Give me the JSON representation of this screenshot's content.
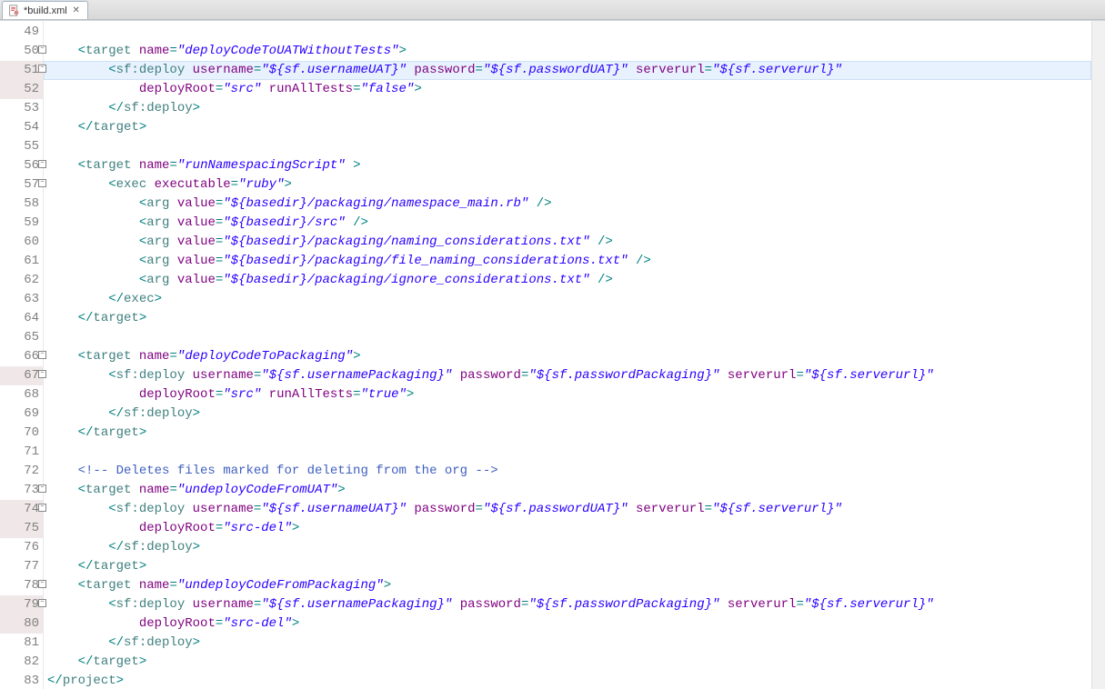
{
  "tab": {
    "filename": "*build.xml"
  },
  "lines": [
    {
      "n": 49,
      "fold": false,
      "mod": false,
      "hl": false,
      "html": ""
    },
    {
      "n": 50,
      "fold": true,
      "mod": false,
      "hl": false,
      "html": "    <span class='punct'>&lt;</span><span class='tag'>target</span> <span class='attr'>name</span><span class='punct'>=</span><span class='val'>\"deployCodeToUATWithoutTests\"</span><span class='punct'>&gt;</span>"
    },
    {
      "n": 51,
      "fold": true,
      "mod": true,
      "hl": true,
      "html": "        <span class='punct'>&lt;</span><span class='tag'>sf:deploy</span> <span class='attr'>username</span><span class='punct'>=</span><span class='val'>\"${sf.usernameUAT}\"</span> <span class='attr'>password</span><span class='punct'>=</span><span class='val'>\"${sf.passwordUAT}\"</span> <span class='attr'>serverurl</span><span class='punct'>=</span><span class='val'>\"${sf.serverurl}\"</span>"
    },
    {
      "n": 52,
      "fold": false,
      "mod": true,
      "hl": false,
      "html": "            <span class='attr'>deployRoot</span><span class='punct'>=</span><span class='val'>\"src\"</span> <span class='attr'>runAllTests</span><span class='punct'>=</span><span class='val'>\"false\"</span><span class='punct'>&gt;</span>"
    },
    {
      "n": 53,
      "fold": false,
      "mod": false,
      "hl": false,
      "html": "        <span class='punct'>&lt;/</span><span class='tag'>sf:deploy</span><span class='punct'>&gt;</span>"
    },
    {
      "n": 54,
      "fold": false,
      "mod": false,
      "hl": false,
      "html": "    <span class='punct'>&lt;/</span><span class='tag'>target</span><span class='punct'>&gt;</span>"
    },
    {
      "n": 55,
      "fold": false,
      "mod": false,
      "hl": false,
      "html": ""
    },
    {
      "n": 56,
      "fold": true,
      "mod": false,
      "hl": false,
      "html": "    <span class='punct'>&lt;</span><span class='tag'>target</span> <span class='attr'>name</span><span class='punct'>=</span><span class='val'>\"runNamespacingScript\"</span> <span class='punct'>&gt;</span>"
    },
    {
      "n": 57,
      "fold": true,
      "mod": false,
      "hl": false,
      "html": "        <span class='punct'>&lt;</span><span class='tag'>exec</span> <span class='attr'>executable</span><span class='punct'>=</span><span class='val'>\"ruby\"</span><span class='punct'>&gt;</span>"
    },
    {
      "n": 58,
      "fold": false,
      "mod": false,
      "hl": false,
      "html": "            <span class='punct'>&lt;</span><span class='tag'>arg</span> <span class='attr'>value</span><span class='punct'>=</span><span class='val'>\"${basedir}/packaging/namespace_main.rb\"</span> <span class='punct'>/&gt;</span>"
    },
    {
      "n": 59,
      "fold": false,
      "mod": false,
      "hl": false,
      "html": "            <span class='punct'>&lt;</span><span class='tag'>arg</span> <span class='attr'>value</span><span class='punct'>=</span><span class='val'>\"${basedir}/src\"</span> <span class='punct'>/&gt;</span>"
    },
    {
      "n": 60,
      "fold": false,
      "mod": false,
      "hl": false,
      "html": "            <span class='punct'>&lt;</span><span class='tag'>arg</span> <span class='attr'>value</span><span class='punct'>=</span><span class='val'>\"${basedir}/packaging/naming_considerations.txt\"</span> <span class='punct'>/&gt;</span>"
    },
    {
      "n": 61,
      "fold": false,
      "mod": false,
      "hl": false,
      "html": "            <span class='punct'>&lt;</span><span class='tag'>arg</span> <span class='attr'>value</span><span class='punct'>=</span><span class='val'>\"${basedir}/packaging/file_naming_considerations.txt\"</span> <span class='punct'>/&gt;</span>"
    },
    {
      "n": 62,
      "fold": false,
      "mod": false,
      "hl": false,
      "html": "            <span class='punct'>&lt;</span><span class='tag'>arg</span> <span class='attr'>value</span><span class='punct'>=</span><span class='val'>\"${basedir}/packaging/ignore_considerations.txt\"</span> <span class='punct'>/&gt;</span>"
    },
    {
      "n": 63,
      "fold": false,
      "mod": false,
      "hl": false,
      "html": "        <span class='punct'>&lt;/</span><span class='tag'>exec</span><span class='punct'>&gt;</span>"
    },
    {
      "n": 64,
      "fold": false,
      "mod": false,
      "hl": false,
      "html": "    <span class='punct'>&lt;/</span><span class='tag'>target</span><span class='punct'>&gt;</span>"
    },
    {
      "n": 65,
      "fold": false,
      "mod": false,
      "hl": false,
      "html": ""
    },
    {
      "n": 66,
      "fold": true,
      "mod": false,
      "hl": false,
      "html": "    <span class='punct'>&lt;</span><span class='tag'>target</span> <span class='attr'>name</span><span class='punct'>=</span><span class='val'>\"deployCodeToPackaging\"</span><span class='punct'>&gt;</span>"
    },
    {
      "n": 67,
      "fold": true,
      "mod": true,
      "hl": false,
      "html": "        <span class='punct'>&lt;</span><span class='tag'>sf:deploy</span> <span class='attr'>username</span><span class='punct'>=</span><span class='val'>\"${sf.usernamePackaging}\"</span> <span class='attr'>password</span><span class='punct'>=</span><span class='val'>\"${sf.passwordPackaging}\"</span> <span class='attr'>serverurl</span><span class='punct'>=</span><span class='val'>\"${sf.serverurl}\"</span>"
    },
    {
      "n": 68,
      "fold": false,
      "mod": false,
      "hl": false,
      "html": "            <span class='attr'>deployRoot</span><span class='punct'>=</span><span class='val'>\"src\"</span> <span class='attr'>runAllTests</span><span class='punct'>=</span><span class='val'>\"true\"</span><span class='punct'>&gt;</span>"
    },
    {
      "n": 69,
      "fold": false,
      "mod": false,
      "hl": false,
      "html": "        <span class='punct'>&lt;/</span><span class='tag'>sf:deploy</span><span class='punct'>&gt;</span>"
    },
    {
      "n": 70,
      "fold": false,
      "mod": false,
      "hl": false,
      "html": "    <span class='punct'>&lt;/</span><span class='tag'>target</span><span class='punct'>&gt;</span>"
    },
    {
      "n": 71,
      "fold": false,
      "mod": false,
      "hl": false,
      "html": ""
    },
    {
      "n": 72,
      "fold": false,
      "mod": false,
      "hl": false,
      "html": "    <span class='cmt'>&lt;!-- Deletes files marked for deleting from the org --&gt;</span>"
    },
    {
      "n": 73,
      "fold": true,
      "mod": false,
      "hl": false,
      "html": "    <span class='punct'>&lt;</span><span class='tag'>target</span> <span class='attr'>name</span><span class='punct'>=</span><span class='val'>\"undeployCodeFromUAT\"</span><span class='punct'>&gt;</span>"
    },
    {
      "n": 74,
      "fold": true,
      "mod": true,
      "hl": false,
      "html": "        <span class='punct'>&lt;</span><span class='tag'>sf:deploy</span> <span class='attr'>username</span><span class='punct'>=</span><span class='val'>\"${sf.usernameUAT}\"</span> <span class='attr'>password</span><span class='punct'>=</span><span class='val'>\"${sf.passwordUAT}\"</span> <span class='attr'>serverurl</span><span class='punct'>=</span><span class='val'>\"${sf.serverurl}\"</span>"
    },
    {
      "n": 75,
      "fold": false,
      "mod": true,
      "hl": false,
      "html": "            <span class='attr'>deployRoot</span><span class='punct'>=</span><span class='val'>\"src-del\"</span><span class='punct'>&gt;</span>"
    },
    {
      "n": 76,
      "fold": false,
      "mod": false,
      "hl": false,
      "html": "        <span class='punct'>&lt;/</span><span class='tag'>sf:deploy</span><span class='punct'>&gt;</span>"
    },
    {
      "n": 77,
      "fold": false,
      "mod": false,
      "hl": false,
      "html": "    <span class='punct'>&lt;/</span><span class='tag'>target</span><span class='punct'>&gt;</span>"
    },
    {
      "n": 78,
      "fold": true,
      "mod": false,
      "hl": false,
      "html": "    <span class='punct'>&lt;</span><span class='tag'>target</span> <span class='attr'>name</span><span class='punct'>=</span><span class='val'>\"undeployCodeFromPackaging\"</span><span class='punct'>&gt;</span>"
    },
    {
      "n": 79,
      "fold": true,
      "mod": true,
      "hl": false,
      "html": "        <span class='punct'>&lt;</span><span class='tag'>sf:deploy</span> <span class='attr'>username</span><span class='punct'>=</span><span class='val'>\"${sf.usernamePackaging}\"</span> <span class='attr'>password</span><span class='punct'>=</span><span class='val'>\"${sf.passwordPackaging}\"</span> <span class='attr'>serverurl</span><span class='punct'>=</span><span class='val'>\"${sf.serverurl}\"</span>"
    },
    {
      "n": 80,
      "fold": false,
      "mod": true,
      "hl": false,
      "html": "            <span class='attr'>deployRoot</span><span class='punct'>=</span><span class='val'>\"src-del\"</span><span class='punct'>&gt;</span>"
    },
    {
      "n": 81,
      "fold": false,
      "mod": false,
      "hl": false,
      "html": "        <span class='punct'>&lt;/</span><span class='tag'>sf:deploy</span><span class='punct'>&gt;</span>"
    },
    {
      "n": 82,
      "fold": false,
      "mod": false,
      "hl": false,
      "html": "    <span class='punct'>&lt;/</span><span class='tag'>target</span><span class='punct'>&gt;</span>"
    },
    {
      "n": 83,
      "fold": false,
      "mod": false,
      "hl": false,
      "html": "<span class='punct'>&lt;/</span><span class='tag'>project</span><span class='punct'>&gt;</span>"
    }
  ]
}
